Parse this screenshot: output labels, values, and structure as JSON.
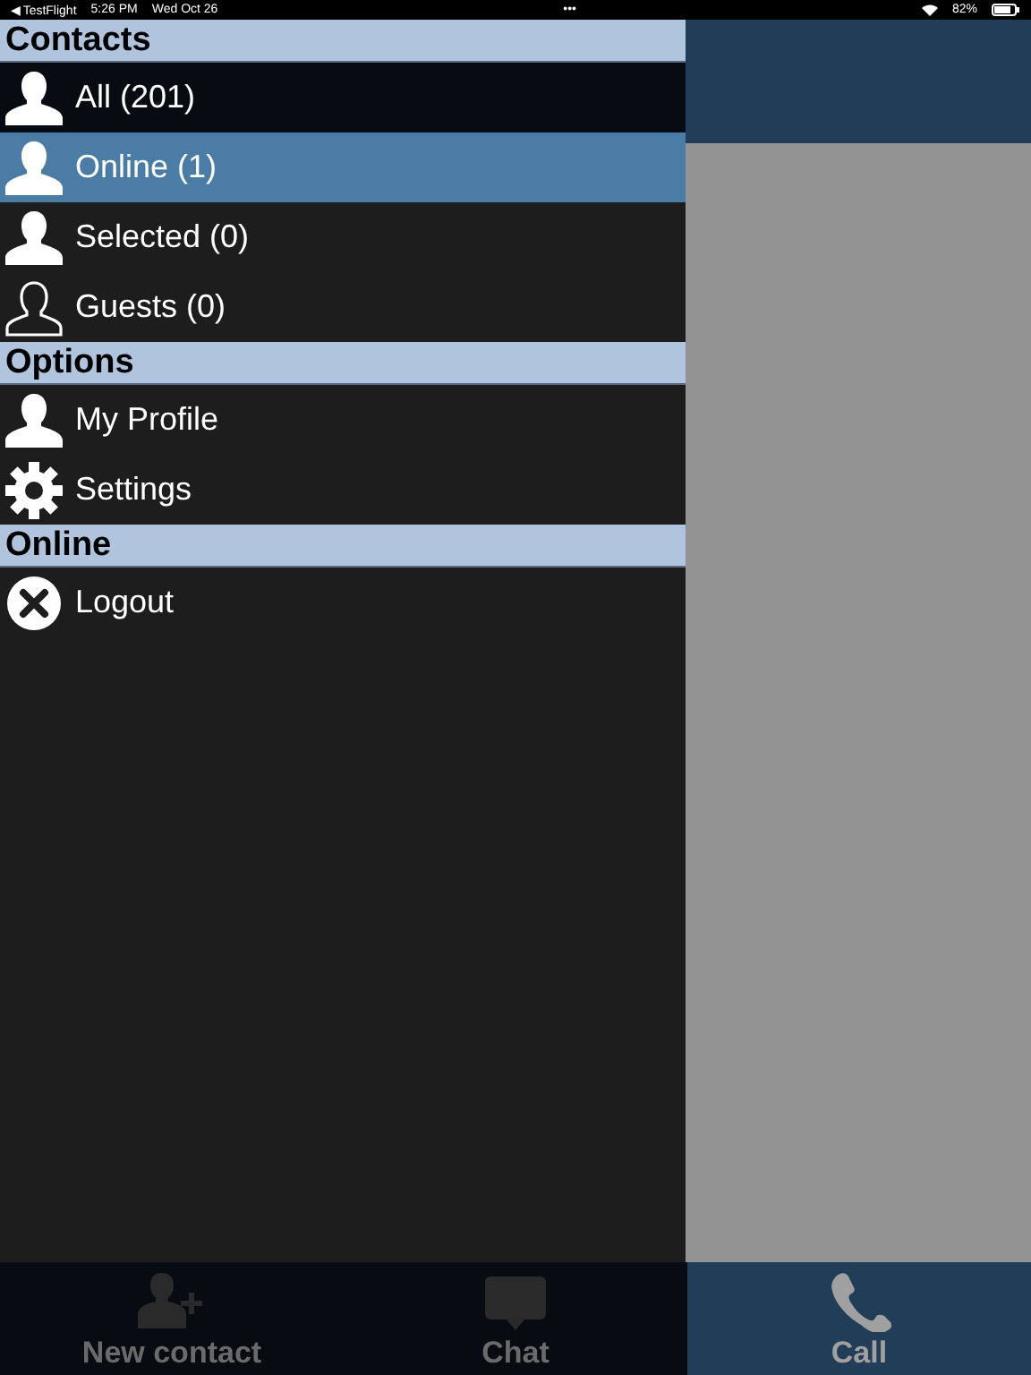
{
  "status_bar": {
    "back_app": "◀ TestFlight",
    "time": "5:26 PM",
    "date": "Wed Oct 26",
    "dots": "•••",
    "battery": "82%"
  },
  "menu": [
    {
      "title": "Contacts",
      "items": [
        {
          "label": "All (201)",
          "kind": "person",
          "selected": false
        },
        {
          "label": "Online (1)",
          "kind": "person",
          "selected": true
        },
        {
          "label": "Selected (0)",
          "kind": "person",
          "selected": false
        },
        {
          "label": "Guests (0)",
          "kind": "person-outline",
          "selected": false
        }
      ]
    },
    {
      "title": "Options",
      "items": [
        {
          "label": "My Profile",
          "kind": "person",
          "selected": false
        },
        {
          "label": "Settings",
          "kind": "gear",
          "selected": false
        }
      ]
    },
    {
      "title": "Online",
      "items": [
        {
          "label": "Logout",
          "kind": "close",
          "selected": false
        }
      ]
    }
  ],
  "tabs": [
    {
      "label": "New contact",
      "kind": "add-person",
      "selected": false
    },
    {
      "label": "Chat",
      "kind": "chat",
      "selected": false
    },
    {
      "label": "Call",
      "kind": "phone",
      "selected": true
    }
  ]
}
